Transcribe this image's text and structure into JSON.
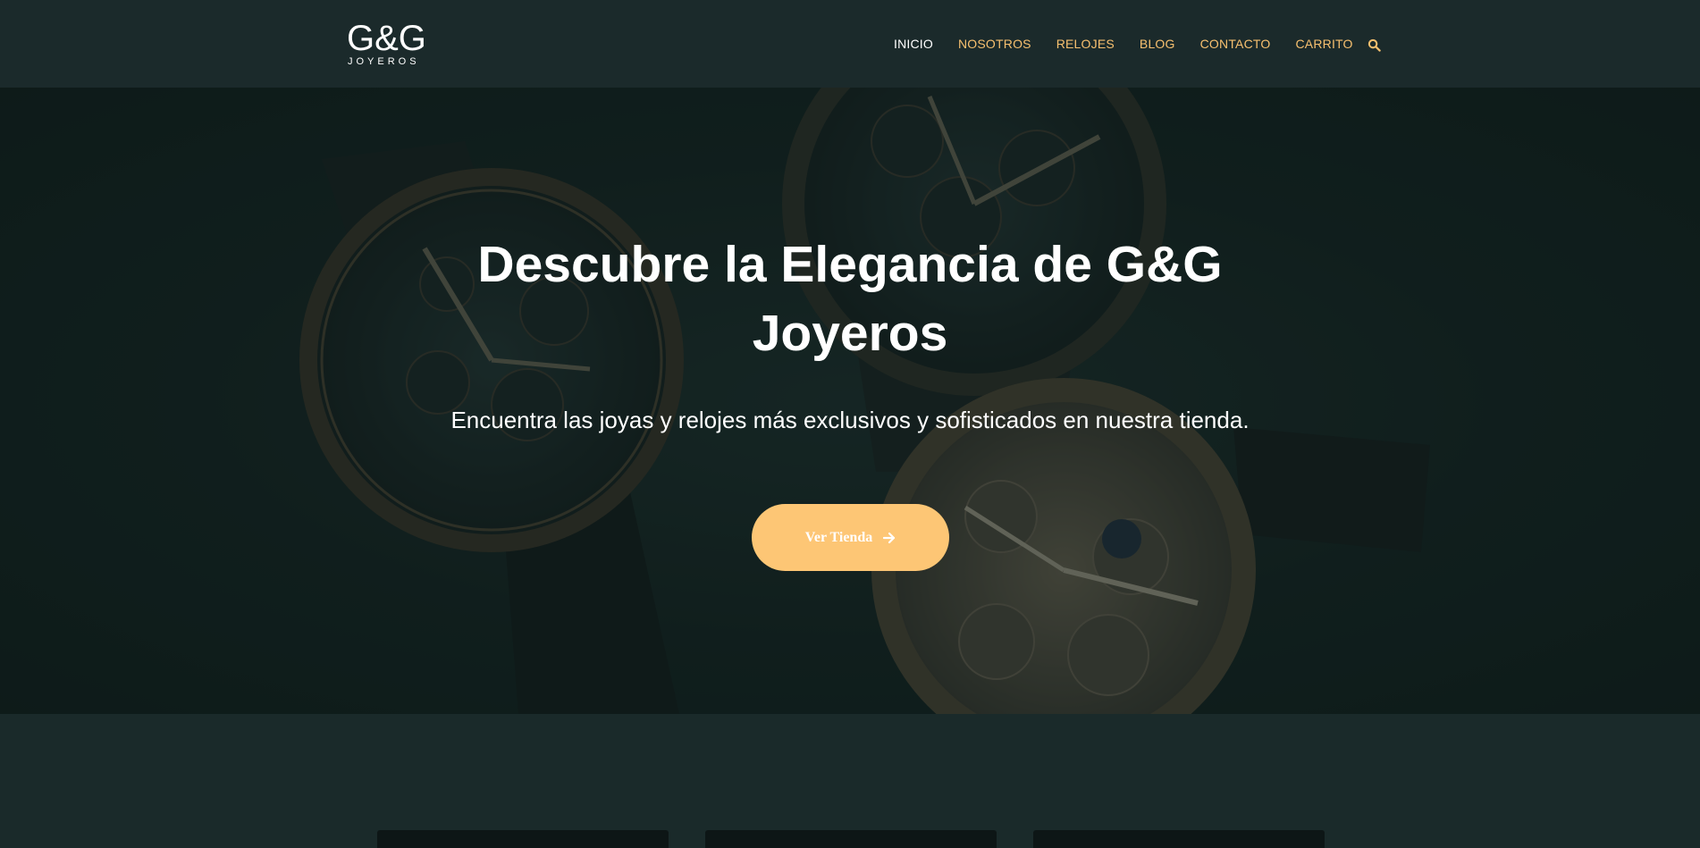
{
  "header": {
    "logo_mark": "G&G",
    "logo_sub": "JOYEROS",
    "nav": [
      {
        "label": "INICIO",
        "active": true
      },
      {
        "label": "NOSOTROS",
        "active": false
      },
      {
        "label": "RELOJES",
        "active": false
      },
      {
        "label": "BLOG",
        "active": false
      },
      {
        "label": "CONTACTO",
        "active": false
      },
      {
        "label": "CARRITO",
        "active": false
      }
    ],
    "search_icon": "search-icon"
  },
  "hero": {
    "title": "Descubre la Elegancia de G&G Joyeros",
    "subtitle": "Encuentra las joyas y relojes más exclusivos y sofisticados en nuestra tienda.",
    "button_label": "Ver Tienda",
    "button_icon": "arrow-right-icon"
  },
  "colors": {
    "header_bg": "#1b2a2b",
    "accent": "#fdc675",
    "nav_text": "#f7c06f",
    "section_bg": "#1a2a2a"
  }
}
